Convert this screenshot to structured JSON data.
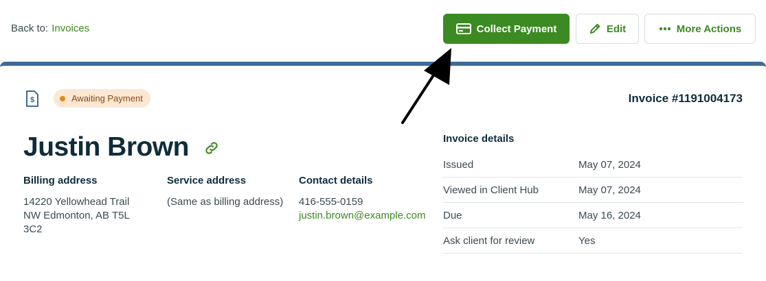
{
  "nav": {
    "back_prefix": "Back to:",
    "back_link": "Invoices"
  },
  "actions": {
    "collect_payment": "Collect Payment",
    "edit": "Edit",
    "more_actions": "More Actions"
  },
  "invoice": {
    "status": "Awaiting Payment",
    "number": "Invoice #1191004173",
    "client_name": "Justin Brown",
    "billing": {
      "heading": "Billing address",
      "lines": [
        "14220 Yellowhead Trail",
        "NW Edmonton, AB T5L",
        "3C2"
      ]
    },
    "service": {
      "heading": "Service address",
      "text": "(Same as billing address)"
    },
    "contact": {
      "heading": "Contact details",
      "phone": "416-555-0159",
      "email": "justin.brown@example.com"
    },
    "details": {
      "heading": "Invoice details",
      "rows": [
        {
          "label": "Issued",
          "value": "May 07, 2024"
        },
        {
          "label": "Viewed in Client Hub",
          "value": "May 07, 2024"
        },
        {
          "label": "Due",
          "value": "May 16, 2024"
        },
        {
          "label": "Ask client for review",
          "value": "Yes"
        }
      ]
    }
  },
  "colors": {
    "accent_green": "#3c8a22",
    "header_bar": "#3f6b96",
    "badge_bg": "#fbe7d4",
    "badge_dot": "#e8881e"
  },
  "icons": [
    "credit-card-icon",
    "pencil-icon",
    "ellipsis-icon",
    "invoice-dollar-icon",
    "link-icon",
    "annotation-arrow"
  ]
}
